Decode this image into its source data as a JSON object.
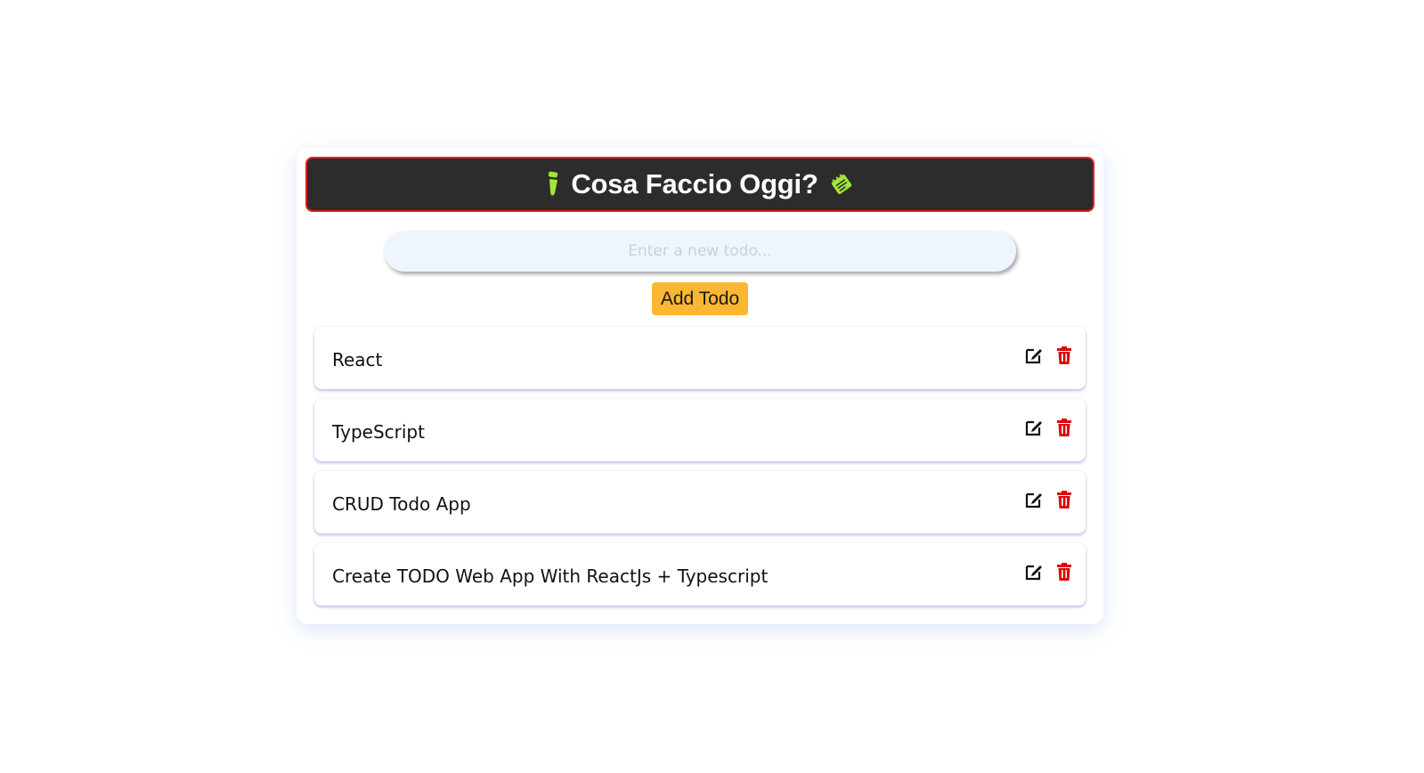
{
  "header": {
    "title": "Cosa Faccio Oggi?",
    "left_icon": "pencil-icon",
    "right_icon": "notepad-icon",
    "accent_color": "#a3e635",
    "border_color": "#e81c1c",
    "background": "#2c2c2c"
  },
  "input": {
    "placeholder": "Enter a new todo...",
    "value": ""
  },
  "add_button": {
    "label": "Add Todo",
    "color": "#fbb731"
  },
  "todos": [
    {
      "text": "React",
      "edit_icon": "edit-icon",
      "delete_icon": "trash-icon"
    },
    {
      "text": "TypeScript",
      "edit_icon": "edit-icon",
      "delete_icon": "trash-icon"
    },
    {
      "text": "CRUD Todo App",
      "edit_icon": "edit-icon",
      "delete_icon": "trash-icon"
    },
    {
      "text": "Create TODO Web App With ReactJs + Typescript",
      "edit_icon": "edit-icon",
      "delete_icon": "trash-icon"
    }
  ],
  "colors": {
    "delete": "#e00000",
    "edit": "#111111"
  }
}
